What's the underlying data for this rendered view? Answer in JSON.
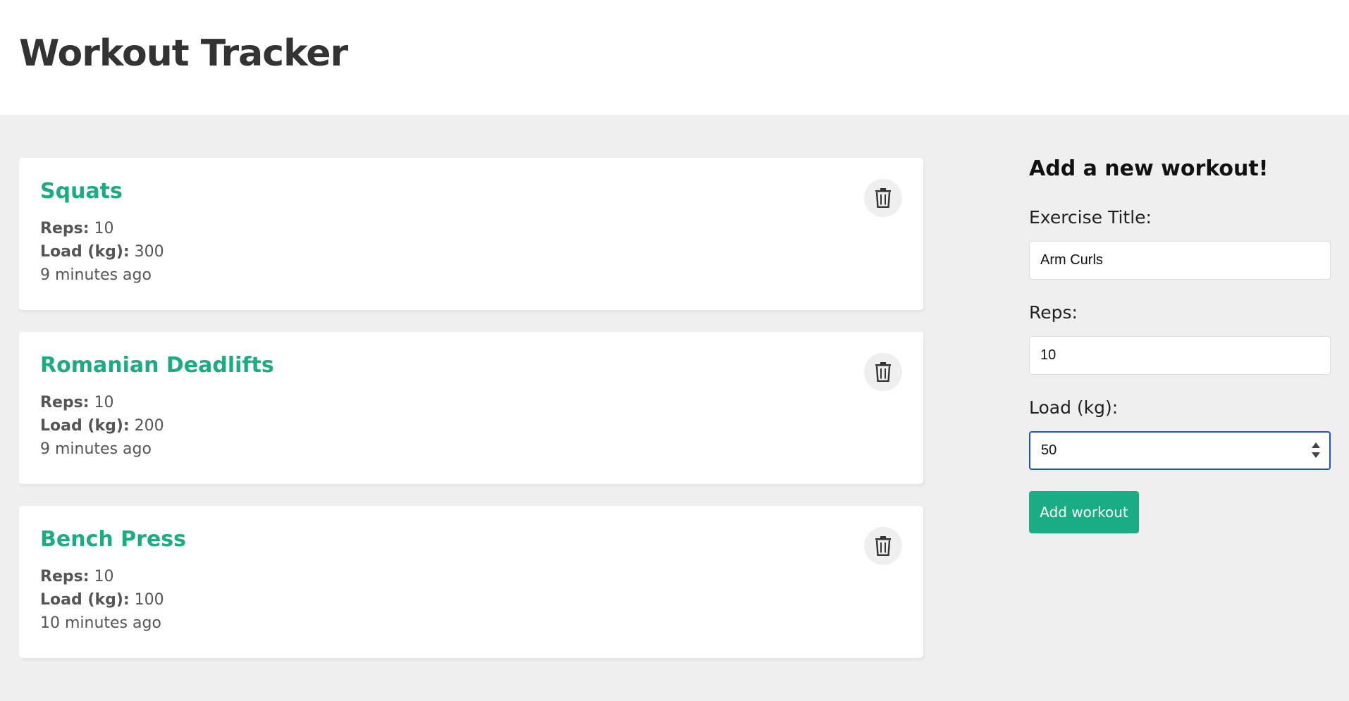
{
  "header": {
    "title": "Workout Tracker"
  },
  "workouts": [
    {
      "title": "Squats",
      "reps_label": "Reps:",
      "reps": "10",
      "load_label": "Load (kg):",
      "load": "300",
      "time": "9 minutes ago"
    },
    {
      "title": "Romanian Deadlifts",
      "reps_label": "Reps:",
      "reps": "10",
      "load_label": "Load (kg):",
      "load": "200",
      "time": "9 minutes ago"
    },
    {
      "title": "Bench Press",
      "reps_label": "Reps:",
      "reps": "10",
      "load_label": "Load (kg):",
      "load": "100",
      "time": "10 minutes ago"
    }
  ],
  "form": {
    "heading": "Add a new workout!",
    "title_label": "Exercise Title:",
    "title_value": "Arm Curls",
    "reps_label": "Reps:",
    "reps_value": "10",
    "load_label": "Load (kg):",
    "load_value": "50",
    "submit_label": "Add workout"
  },
  "colors": {
    "accent": "#1aac83",
    "background": "#efefef",
    "focus": "#1a54c8"
  },
  "icons": {
    "delete": "trash-icon"
  }
}
